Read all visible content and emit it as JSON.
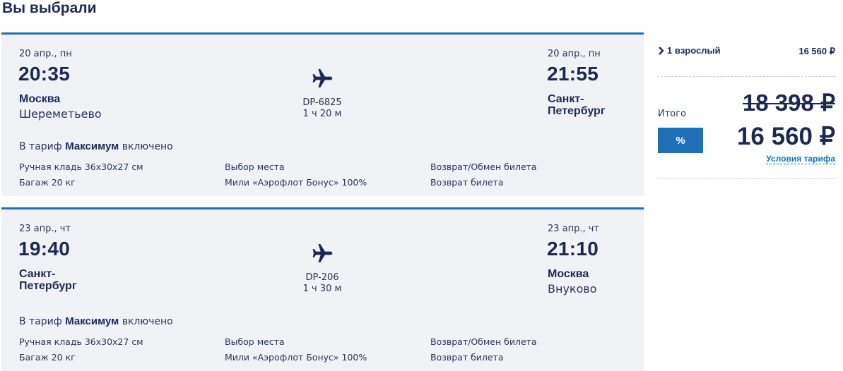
{
  "page": {
    "title": "Вы выбрали"
  },
  "flights": [
    {
      "departure": {
        "date": "20 апр., пн",
        "time": "20:35",
        "city": "Москва",
        "airport": "Шереметьево"
      },
      "flight_number": "DP-6825",
      "duration": "1 ч 20 м",
      "arrival": {
        "date": "20 апр., пн",
        "time": "21:55",
        "city_line1": "Санкт-",
        "city_line2": "Петербург",
        "airport": ""
      },
      "tariff_prefix": "В тариф",
      "tariff_name": "Максимум",
      "tariff_suffix": "включено",
      "features": [
        "Ручная кладь 36х30х27 см",
        "Выбор места",
        "Возврат/Обмен билета",
        "Багаж 20 кг",
        "Мили «Аэрофлот Бонус» 100%",
        "Возврат билета"
      ],
      "icon": "airplane-icon"
    },
    {
      "departure": {
        "date": "23 апр., чт",
        "time": "19:40",
        "city_line1": "Санкт-",
        "city_line2": "Петербург",
        "airport": ""
      },
      "flight_number": "DP-206",
      "duration": "1 ч 30 м",
      "arrival": {
        "date": "23 апр., чт",
        "time": "21:10",
        "city": "Москва",
        "airport": "Внуково"
      },
      "tariff_prefix": "В тариф",
      "tariff_name": "Максимум",
      "tariff_suffix": "включено",
      "features": [
        "Ручная кладь 36х30х27 см",
        "Выбор места",
        "Возврат/Обмен билета",
        "Багаж 20 кг",
        "Мили «Аэрофлот Бонус» 100%",
        "Возврат билета"
      ],
      "icon": "airplane-icon"
    }
  ],
  "summary": {
    "passengers_label": "1 взрослый",
    "passengers_price": "16 560 ₽",
    "total_label": "Итого",
    "old_price": "18 398 ₽",
    "discount_label": "%",
    "new_price": "16 560 ₽",
    "terms_link": "Условия тарифа"
  },
  "colors": {
    "accent": "#1f6fb8",
    "text": "#1c2a52",
    "card_bg": "#f1f2f5"
  }
}
